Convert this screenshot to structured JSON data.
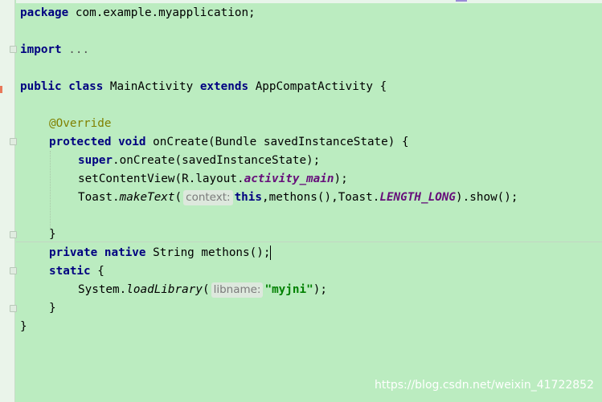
{
  "editor": {
    "package_kw": "package",
    "package_name": " com.example.myapplication;",
    "import_kw": "import",
    "import_folded": " ...",
    "public_kw": "public",
    "class_kw": "class",
    "class_name": " MainActivity ",
    "extends_kw": "extends",
    "super_class": " AppCompatActivity {",
    "annotation": "@Override",
    "protected_kw": "protected",
    "void_kw": "void",
    "oncreate_sig": " onCreate(Bundle savedInstanceState) {",
    "super_kw": "super",
    "super_call": ".onCreate(savedInstanceState);",
    "set_content_prefix": "setContentView(R.layout.",
    "layout_const": "activity_main",
    "set_content_suffix": ");",
    "toast_prefix": "Toast.",
    "make_text": "makeText",
    "open_paren": "(",
    "hint_context": "context:",
    "this_kw": "this",
    "toast_mid": ",methons(),Toast.",
    "length_const": "LENGTH_LONG",
    "toast_suffix": ").show();",
    "close_brace": "}",
    "private_kw": "private",
    "native_kw": "native",
    "native_decl": " String methons();",
    "static_kw": "static",
    "static_open": " {",
    "system_prefix": "System.",
    "load_library": "loadLibrary",
    "hint_libname": "libname:",
    "lib_string": "\"myjni\"",
    "load_suffix": ");"
  },
  "watermark": "https://blog.csdn.net/weixin_41722852",
  "colors": {
    "background": "#bbecc0",
    "keyword": "#000080",
    "annotation": "#808000",
    "constant": "#660e7a",
    "string": "#008000",
    "hint_bg": "#dde8dd"
  }
}
